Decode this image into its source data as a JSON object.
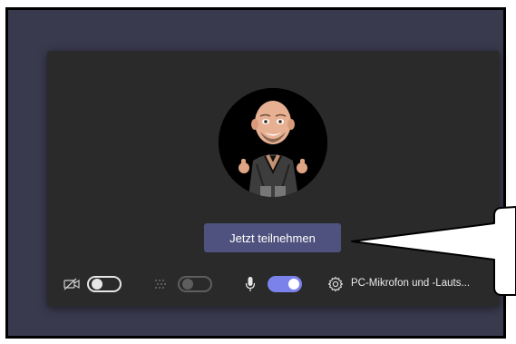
{
  "join_button": {
    "label": "Jetzt teilnehmen"
  },
  "controls": {
    "camera": {
      "icon": "camera-off-icon",
      "state": "off"
    },
    "background_effects": {
      "icon": "background-blur-icon",
      "state": "disabled"
    },
    "microphone": {
      "icon": "microphone-icon",
      "state": "on"
    },
    "device_settings": {
      "icon": "gear-icon",
      "label": "PC-Mikrofon und -Lauts..."
    }
  },
  "colors": {
    "frame_bg": "#393a4e",
    "panel_bg": "#2a2a2a",
    "button_bg": "#4f527e",
    "toggle_on": "#7b83eb",
    "text": "#eaeaea"
  }
}
